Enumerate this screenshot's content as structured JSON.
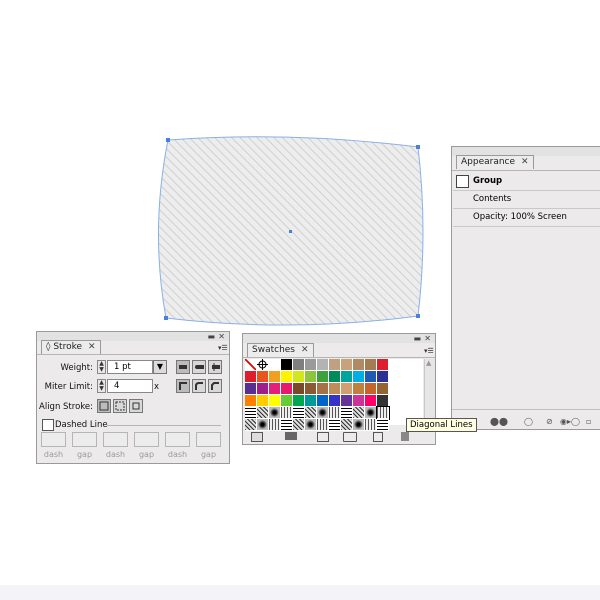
{
  "stroke_panel": {
    "tab": "Stroke",
    "weight_label": "Weight:",
    "weight_value": "1 pt",
    "miter_label": "Miter Limit:",
    "miter_value": "4",
    "miter_suffix": "x",
    "align_label": "Align Stroke:",
    "dashed_label": "Dashed Line",
    "dash_labels": [
      "dash",
      "gap",
      "dash",
      "gap",
      "dash",
      "gap"
    ]
  },
  "swatches_panel": {
    "tab": "Swatches",
    "rows": [
      [
        "none",
        "reg",
        "#ffffff",
        "#000000",
        "#7f7f7f",
        "#9a9a9a",
        "#b3b3b3",
        "#c0a080",
        "#c8a27a",
        "#b08a64",
        "#a57c52",
        "#dc1e2e"
      ],
      [
        "#dc1e2e",
        "#e8561e",
        "#f0a01e",
        "#fff200",
        "#d2e61e",
        "#8cc63e",
        "#3ca03c",
        "#008c5a",
        "#00a49a",
        "#00aee6",
        "#1e5ab4",
        "#2d3092"
      ],
      [
        "#5a2d91",
        "#a01e8c",
        "#e61e78",
        "#e6196e",
        "#7a4a28",
        "#8c5a32",
        "#a87046",
        "#c08c5a",
        "#d2a070",
        "#c08040",
        "#c86428",
        "#966432"
      ],
      [
        "#ff8000",
        "#ffcc00",
        "#ffff00",
        "#66cc33",
        "#00a651",
        "#009999",
        "#0066cc",
        "#3333cc",
        "#663399",
        "#cc3399",
        "#ff0066",
        "#333333"
      ]
    ],
    "pattern_rows": 2
  },
  "appearance_panel": {
    "tab": "Appearance",
    "group_label": "Group",
    "contents_label": "Contents",
    "opacity_label": "Opacity: 100% Screen"
  },
  "tooltip": "Diagonal Lines",
  "colors": {
    "selection_blue": "#4a7fdc",
    "panel_bg": "#eceaea"
  }
}
